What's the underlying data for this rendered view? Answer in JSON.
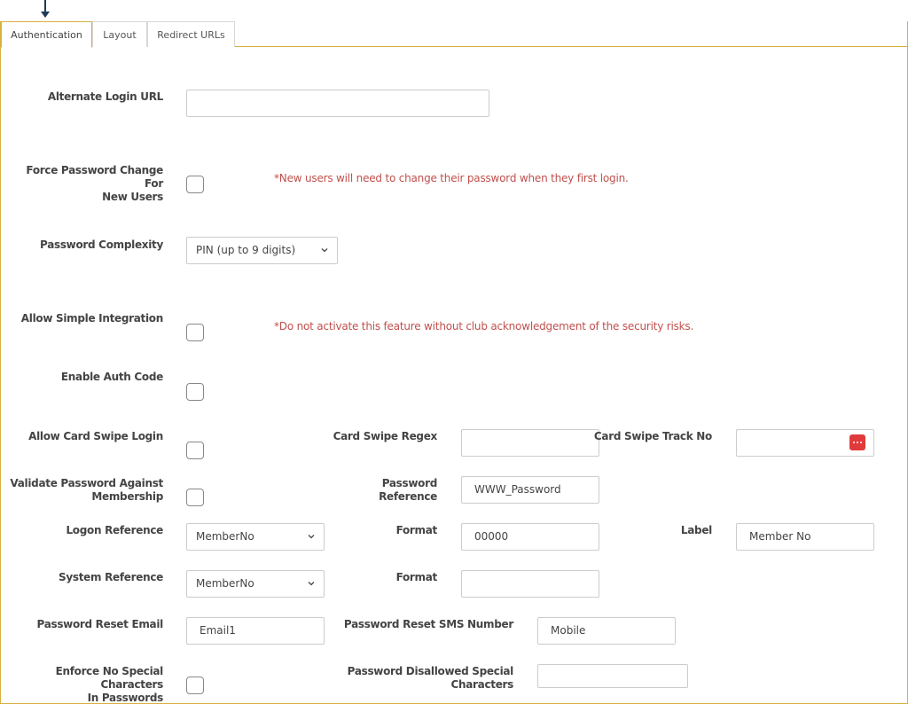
{
  "tabs": {
    "authentication": "Authentication",
    "layout": "Layout",
    "redirect_urls": "Redirect URLs"
  },
  "labels": {
    "alternate_login_url": "Alternate Login URL",
    "force_password_change_1": "Force Password Change For",
    "force_password_change_2": "New Users",
    "password_complexity": "Password Complexity",
    "allow_simple_integration": "Allow Simple Integration",
    "enable_auth_code": "Enable Auth Code",
    "allow_card_swipe_login": "Allow Card Swipe Login",
    "card_swipe_regex": "Card Swipe Regex",
    "card_swipe_track_no": "Card Swipe Track No",
    "validate_password_1": "Validate Password Against",
    "validate_password_2": "Membership",
    "password_reference_1": "Password",
    "password_reference_2": "Reference",
    "logon_reference": "Logon Reference",
    "format_1": "Format",
    "label": "Label",
    "system_reference": "System Reference",
    "format_2": "Format",
    "password_reset_email": "Password Reset Email",
    "password_reset_sms": "Password Reset SMS Number",
    "enforce_no_special_1": "Enforce No Special Characters",
    "enforce_no_special_2": "In Passwords",
    "disallowed_special_1": "Password Disallowed Special",
    "disallowed_special_2": "Characters"
  },
  "notes": {
    "force_password_change": "*New users will need to change their password when they first login.",
    "simple_integration": "*Do not activate this feature without club acknowledgement of the security risks."
  },
  "values": {
    "alternate_login_url": "",
    "password_complexity": "PIN (up to 9 digits)",
    "card_swipe_regex": "",
    "card_swipe_track_no": "",
    "password_reference": "WWW_Password",
    "logon_reference": "MemberNo",
    "logon_format": "00000",
    "logon_label": "Member No",
    "system_reference": "MemberNo",
    "system_format": "",
    "password_reset_email": "Email1",
    "password_reset_sms": "Mobile",
    "disallowed_special": ""
  },
  "colors": {
    "accent_border": "#d8b03c",
    "note_text": "#c0504d",
    "dots_button": "#e03a3a",
    "arrow": "#1f3b57"
  }
}
